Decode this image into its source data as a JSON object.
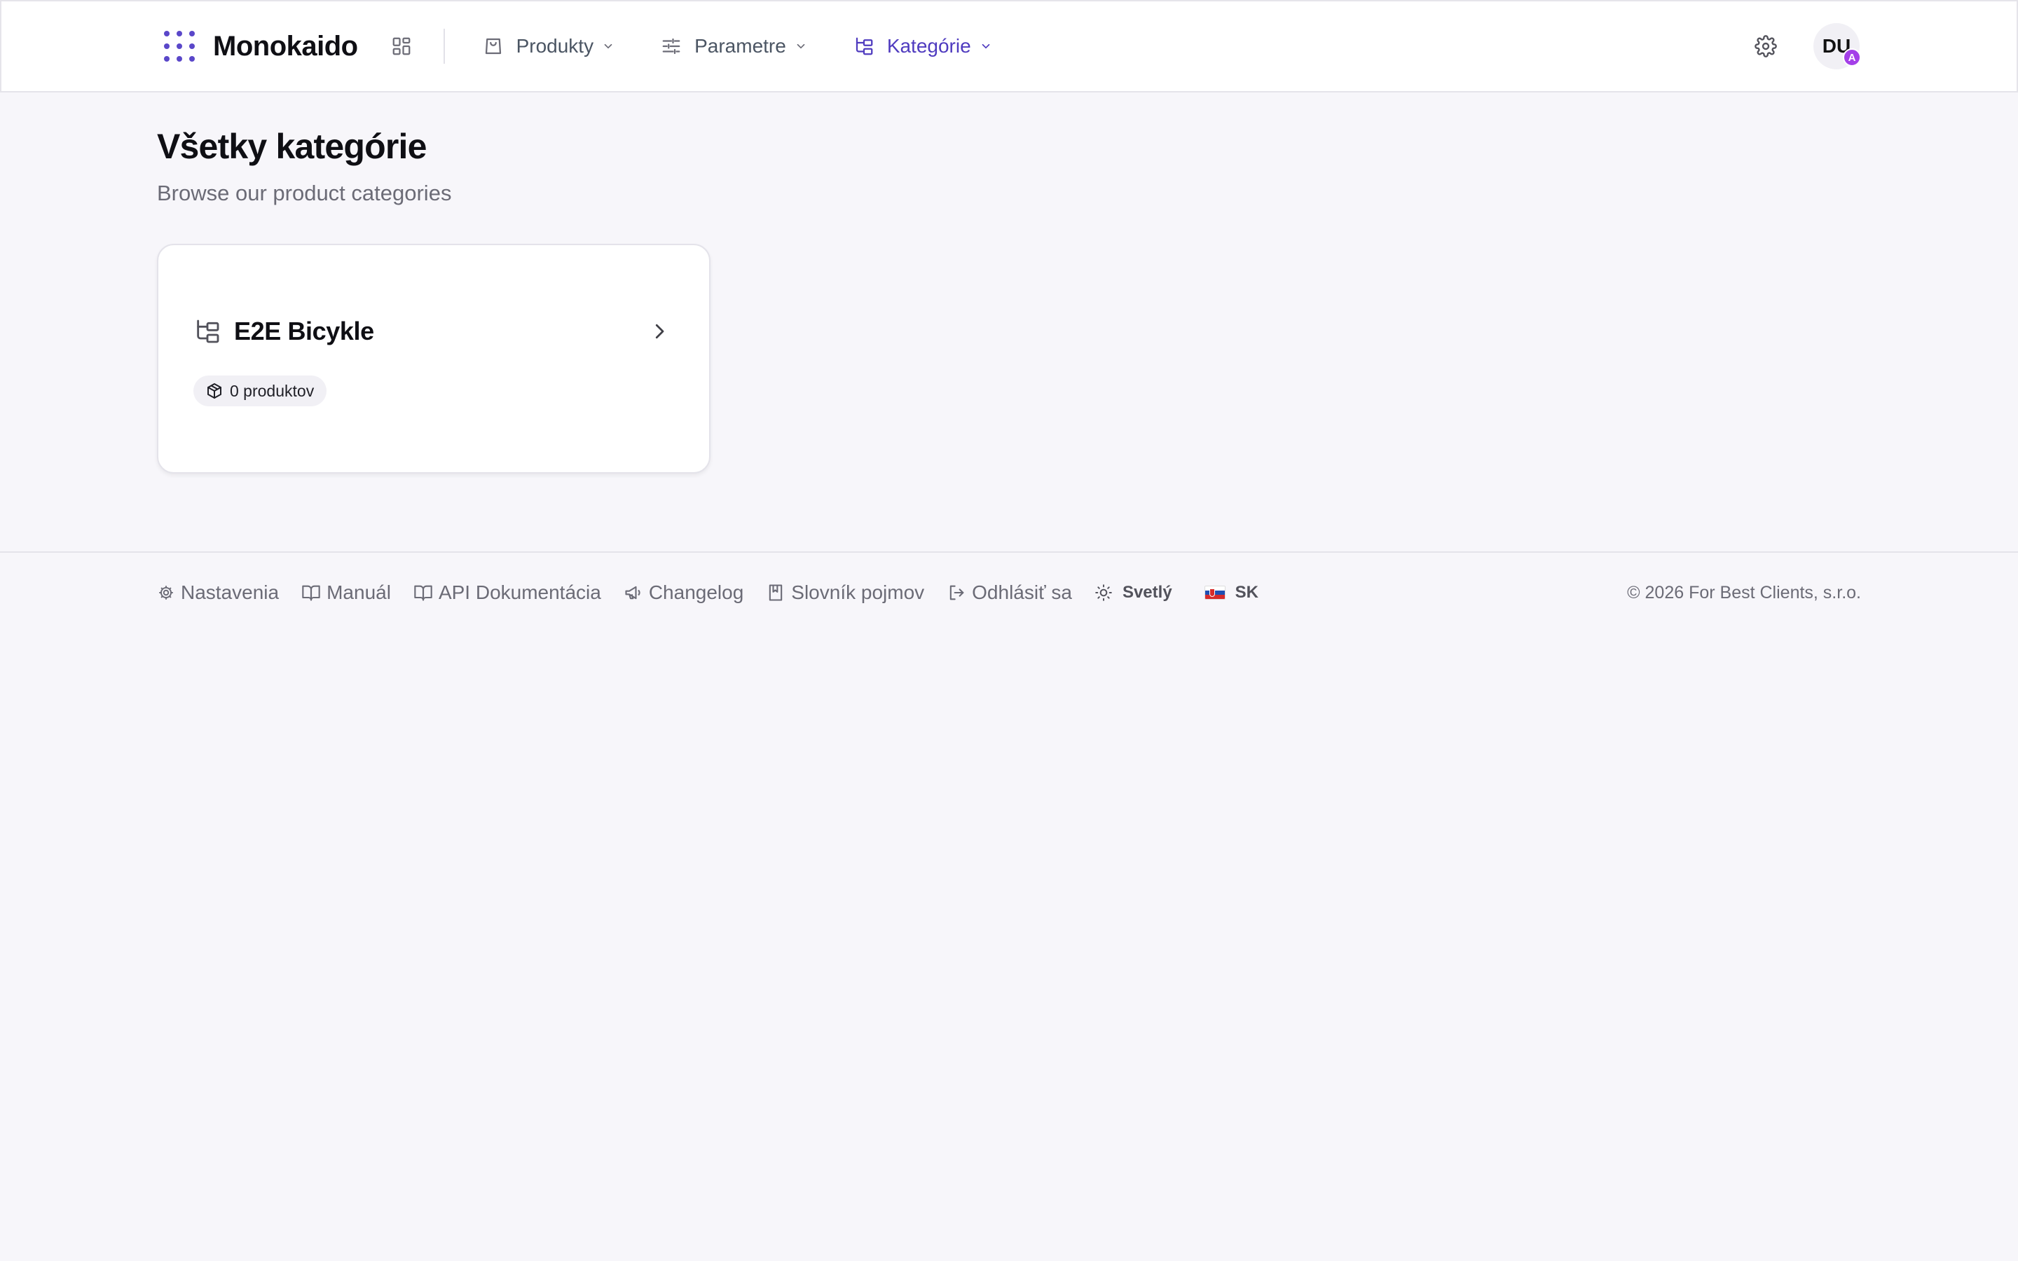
{
  "header": {
    "brand": "Monokaido",
    "nav": [
      {
        "label": "Produkty",
        "icon": "shopping-bag-icon",
        "active": false
      },
      {
        "label": "Parametre",
        "icon": "sliders-icon",
        "active": false
      },
      {
        "label": "Kategórie",
        "icon": "folder-tree-icon",
        "active": true
      }
    ],
    "avatar_initials": "DU",
    "avatar_badge": "A"
  },
  "main": {
    "title": "Všetky kategórie",
    "subtitle": "Browse our product categories",
    "categories": [
      {
        "name": "E2E Bicykle",
        "count_label": "0 produktov"
      }
    ]
  },
  "footer": {
    "links": [
      {
        "label": "Nastavenia",
        "icon": "gear-icon"
      },
      {
        "label": "Manuál",
        "icon": "book-open-icon"
      },
      {
        "label": "API Dokumentácia",
        "icon": "book-open-icon"
      },
      {
        "label": "Changelog",
        "icon": "megaphone-icon"
      },
      {
        "label": "Slovník pojmov",
        "icon": "book-icon"
      },
      {
        "label": "Odhlásiť sa",
        "icon": "logout-icon"
      }
    ],
    "theme_label": "Svetlý",
    "language_label": "SK",
    "copyright": "© 2026 For Best Clients, s.r.o."
  },
  "colors": {
    "accent": "#4f3bbf",
    "background": "#f7f6fa",
    "badge": "#a43fe8"
  }
}
